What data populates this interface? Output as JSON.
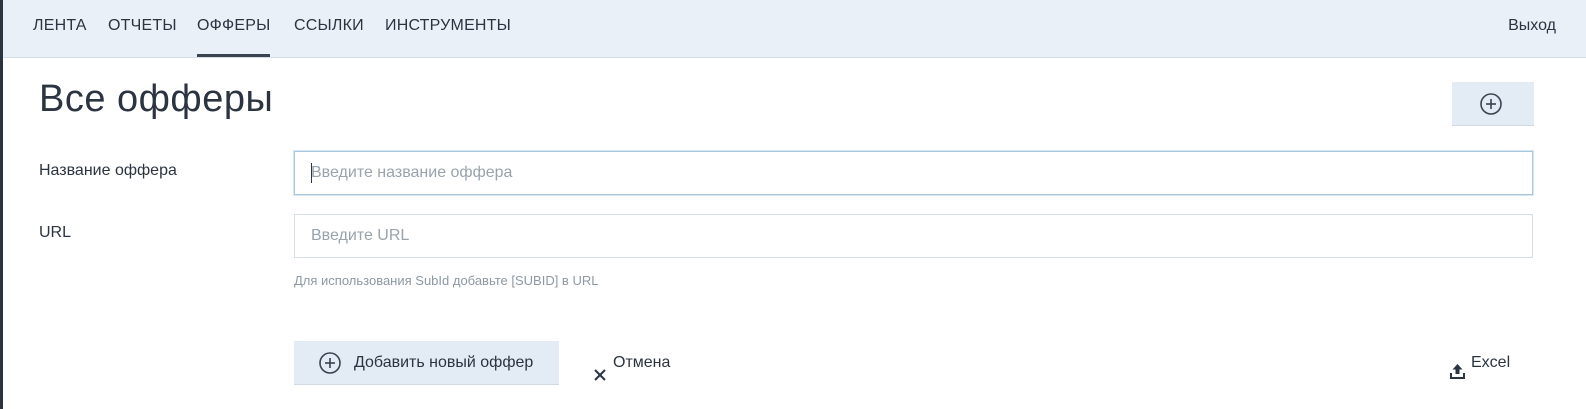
{
  "nav": {
    "items": [
      {
        "label": "ЛЕНТА",
        "active": false
      },
      {
        "label": "ОТЧЕТЫ",
        "active": false
      },
      {
        "label": "ОФФЕРЫ",
        "active": true
      },
      {
        "label": "ССЫЛКИ",
        "active": false
      },
      {
        "label": "ИНСТРУМЕНТЫ",
        "active": false
      }
    ],
    "logout": "Выход"
  },
  "page": {
    "title": "Все офферы",
    "add_icon": "plus-circle-icon"
  },
  "form": {
    "name_label": "Название оффера",
    "name_value": "",
    "name_placeholder": "Введите название оффера",
    "url_label": "URL",
    "url_value": "",
    "url_placeholder": "Введите URL",
    "hint": "Для использования SubId добавьте [SUBID] в URL"
  },
  "actions": {
    "add_label": "Добавить новый оффер",
    "cancel_label": "Отмена",
    "excel_label": "Excel"
  },
  "colors": {
    "nav_bg": "#e9f0f7",
    "button_bg": "#e3ecf4",
    "text": "#2b3440",
    "placeholder": "#98a3ae"
  }
}
